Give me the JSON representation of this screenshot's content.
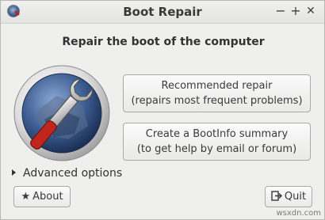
{
  "window": {
    "title": "Boot Repair",
    "controls": {
      "minimize": "−",
      "maximize": "+",
      "close": "✕"
    }
  },
  "main": {
    "heading": "Repair the boot of the computer",
    "recommended": {
      "line1": "Recommended repair",
      "line2": "(repairs most frequent problems)"
    },
    "bootinfo": {
      "line1": "Create a BootInfo summary",
      "line2": "(to get help by email or forum)"
    },
    "advanced_label": "Advanced options"
  },
  "footer": {
    "about_label": "About",
    "about_icon": "★",
    "quit_label": "Quit",
    "watermark": "wsxdn.com"
  },
  "colors": {
    "accent_red": "#c0261c",
    "logo_blue": "#3e5f93"
  }
}
